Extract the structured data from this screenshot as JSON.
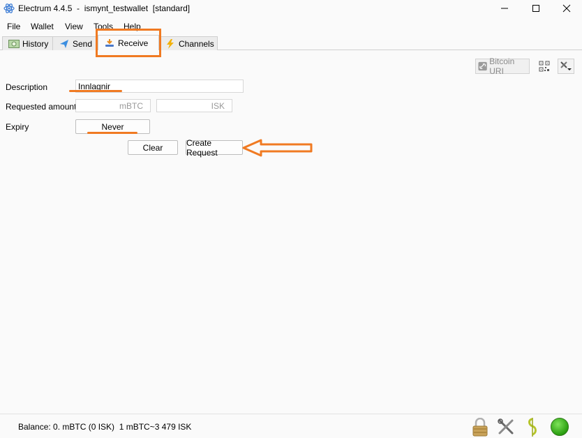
{
  "window": {
    "title": "Electrum 4.4.5  -  ismynt_testwallet  [standard]"
  },
  "menu": {
    "file": "File",
    "wallet": "Wallet",
    "view": "View",
    "tools": "Tools",
    "help": "Help"
  },
  "tabs": [
    {
      "label": "History",
      "icon": "history-icon",
      "active": false
    },
    {
      "label": "Send",
      "icon": "send-icon",
      "active": false
    },
    {
      "label": "Receive",
      "icon": "receive-icon",
      "active": true
    },
    {
      "label": "Channels",
      "icon": "lightning-icon",
      "active": false
    }
  ],
  "toolbar": {
    "bitcoin_uri_label": "Bitcoin URI",
    "qr_icon": "qr-code-icon",
    "tools_icon": "tools-menu-icon"
  },
  "form": {
    "description_label": "Description",
    "description_value": "Innlagnir",
    "amount_label": "Requested amount",
    "amount_btc_unit": "mBTC",
    "amount_fiat_unit": "ISK",
    "expiry_label": "Expiry",
    "expiry_value": "Never",
    "clear_label": "Clear",
    "create_label": "Create Request"
  },
  "status": {
    "balance": "Balance: 0. mBTC (0 ISK)  1 mBTC~3 479 ISK"
  },
  "colors": {
    "annotation": "#f07a22",
    "network_ok": "#2a9e10"
  }
}
